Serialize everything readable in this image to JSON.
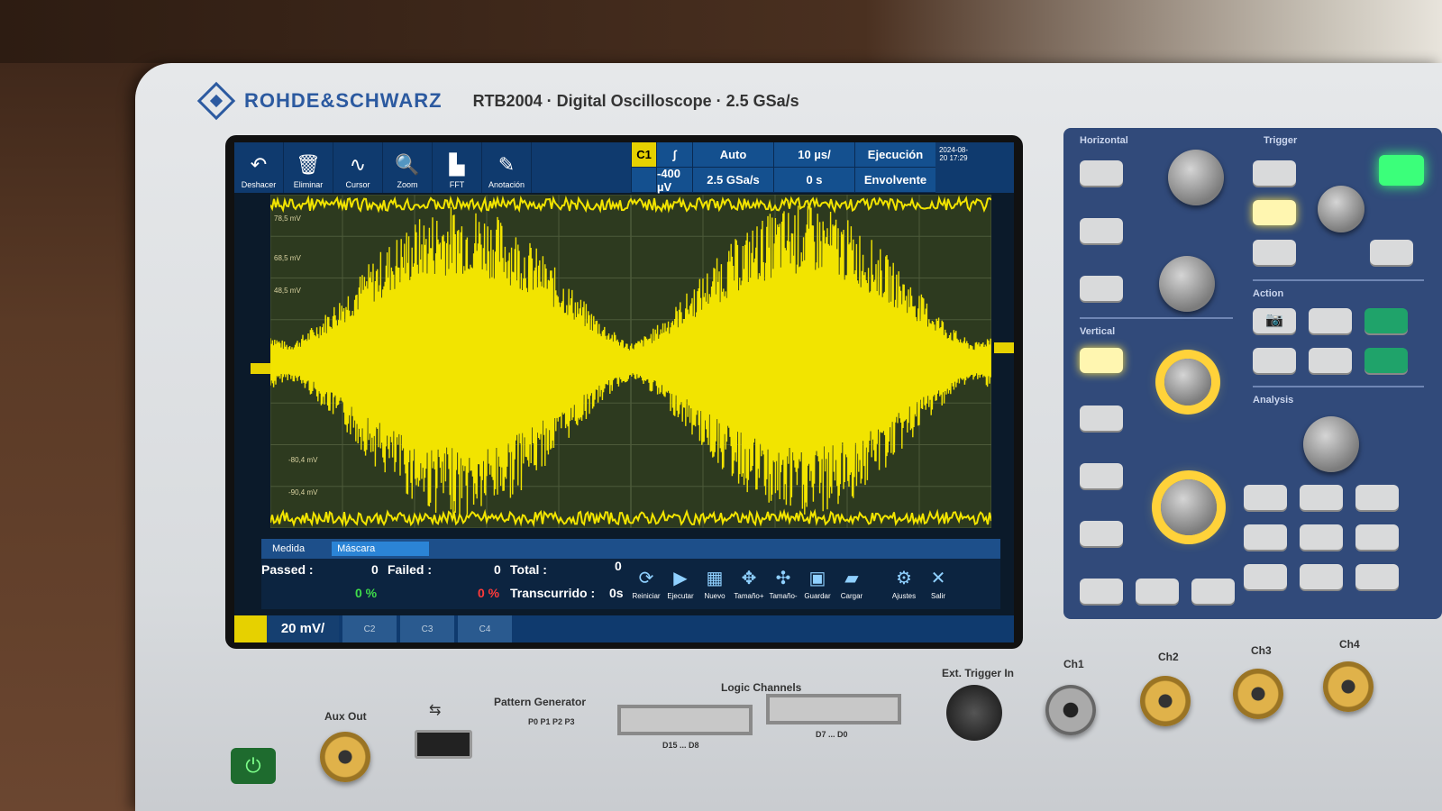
{
  "brand": {
    "name": "ROHDE&SCHWARZ",
    "model": "RTB2004 · Digital Oscilloscope · 2.5 GSa/s"
  },
  "toolbar": {
    "tools": [
      {
        "label": "Deshacer",
        "icon": "undo-icon"
      },
      {
        "label": "Eliminar",
        "icon": "trash-icon"
      },
      {
        "label": "Cursor",
        "icon": "cursor-icon"
      },
      {
        "label": "Zoom",
        "icon": "zoom-icon"
      },
      {
        "label": "FFT",
        "icon": "fft-icon"
      },
      {
        "label": "Anotación",
        "icon": "pencil-icon"
      }
    ]
  },
  "settings": {
    "channel": "C1",
    "trigger_slope": "∫",
    "trigger_mode": "Auto",
    "timebase": "10 µs/",
    "run_state": "Ejecución",
    "trigger_level": "-400 µV",
    "sample_rate": "2.5 GSa/s",
    "position": "0 s",
    "acq_mode": "Envolvente",
    "datetime": "2024-08-20 17:29"
  },
  "grid_labels": [
    "78,5 mV",
    "68,5 mV",
    "48,5 mV",
    "-80,4 mV",
    "-90,4 mV"
  ],
  "measurement": {
    "tab1": "Medida",
    "tab2": "Máscara",
    "passed_label": "Passed :",
    "passed_value": "0",
    "passed_pct": "0 %",
    "failed_label": "Failed :",
    "failed_value": "0",
    "failed_pct": "0 %",
    "total_label": "Total :",
    "total_value": "0",
    "elapsed_label": "Transcurrido :",
    "elapsed_value": "0s",
    "buttons": [
      "Reiniciar",
      "Ejecutar",
      "Nuevo",
      "Tamaño+",
      "Tamaño-",
      "Guardar",
      "Cargar",
      "Ajustes",
      "Salir"
    ]
  },
  "channel_bar": {
    "scale": "20 mV/",
    "others": [
      "C2",
      "C3",
      "C4"
    ]
  },
  "panel": {
    "horizontal": "Horizontal",
    "trigger": "Trigger",
    "vertical": "Vertical",
    "action": "Action",
    "analysis": "Analysis"
  },
  "front": {
    "aux_out": "Aux Out",
    "pattern_gen": "Pattern Generator",
    "pattern_pins": "P0  P1  P2  P3",
    "logic": "Logic Channels",
    "logic_a": "D15 ... D8",
    "logic_b": "D7 ... D0",
    "ext_trig": "Ext. Trigger In",
    "channels": [
      "Ch1",
      "Ch2",
      "Ch3",
      "Ch4"
    ]
  },
  "colors": {
    "trace": "#f2e400",
    "screen_bg": "#2d3a1f",
    "toolbar": "#0f3a6e",
    "brand": "#2c5aa0"
  }
}
